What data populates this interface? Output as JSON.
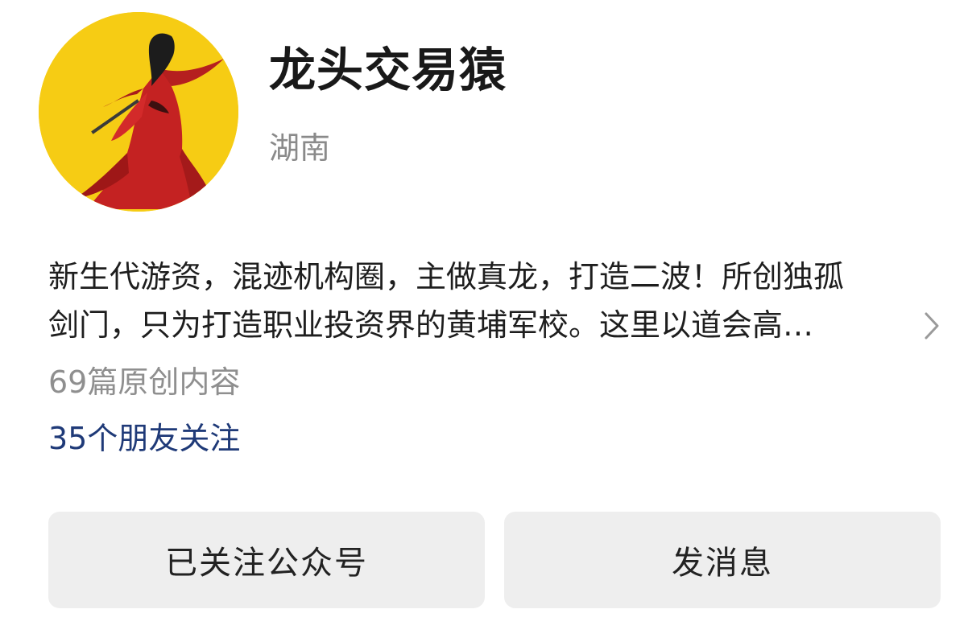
{
  "profile": {
    "name": "龙头交易猿",
    "region": "湖南",
    "avatar_icon": "red-robed-swordsman-avatar",
    "avatar_background": "#f6cc14"
  },
  "bio": {
    "line1": "新生代游资，混迹机构圈，主做真龙，打造二波！所创独孤",
    "line2": "剑门，只为打造职业投资界的黄埔军校。这里以道会高…",
    "expand_icon": "chevron-right-icon"
  },
  "stats": {
    "articles": "69篇原创内容",
    "friends_following": "35个朋友关注",
    "friends_color": "#1f3a78"
  },
  "actions": {
    "followed_label": "已关注公众号",
    "message_label": "发消息",
    "button_background": "#eeeeee"
  }
}
